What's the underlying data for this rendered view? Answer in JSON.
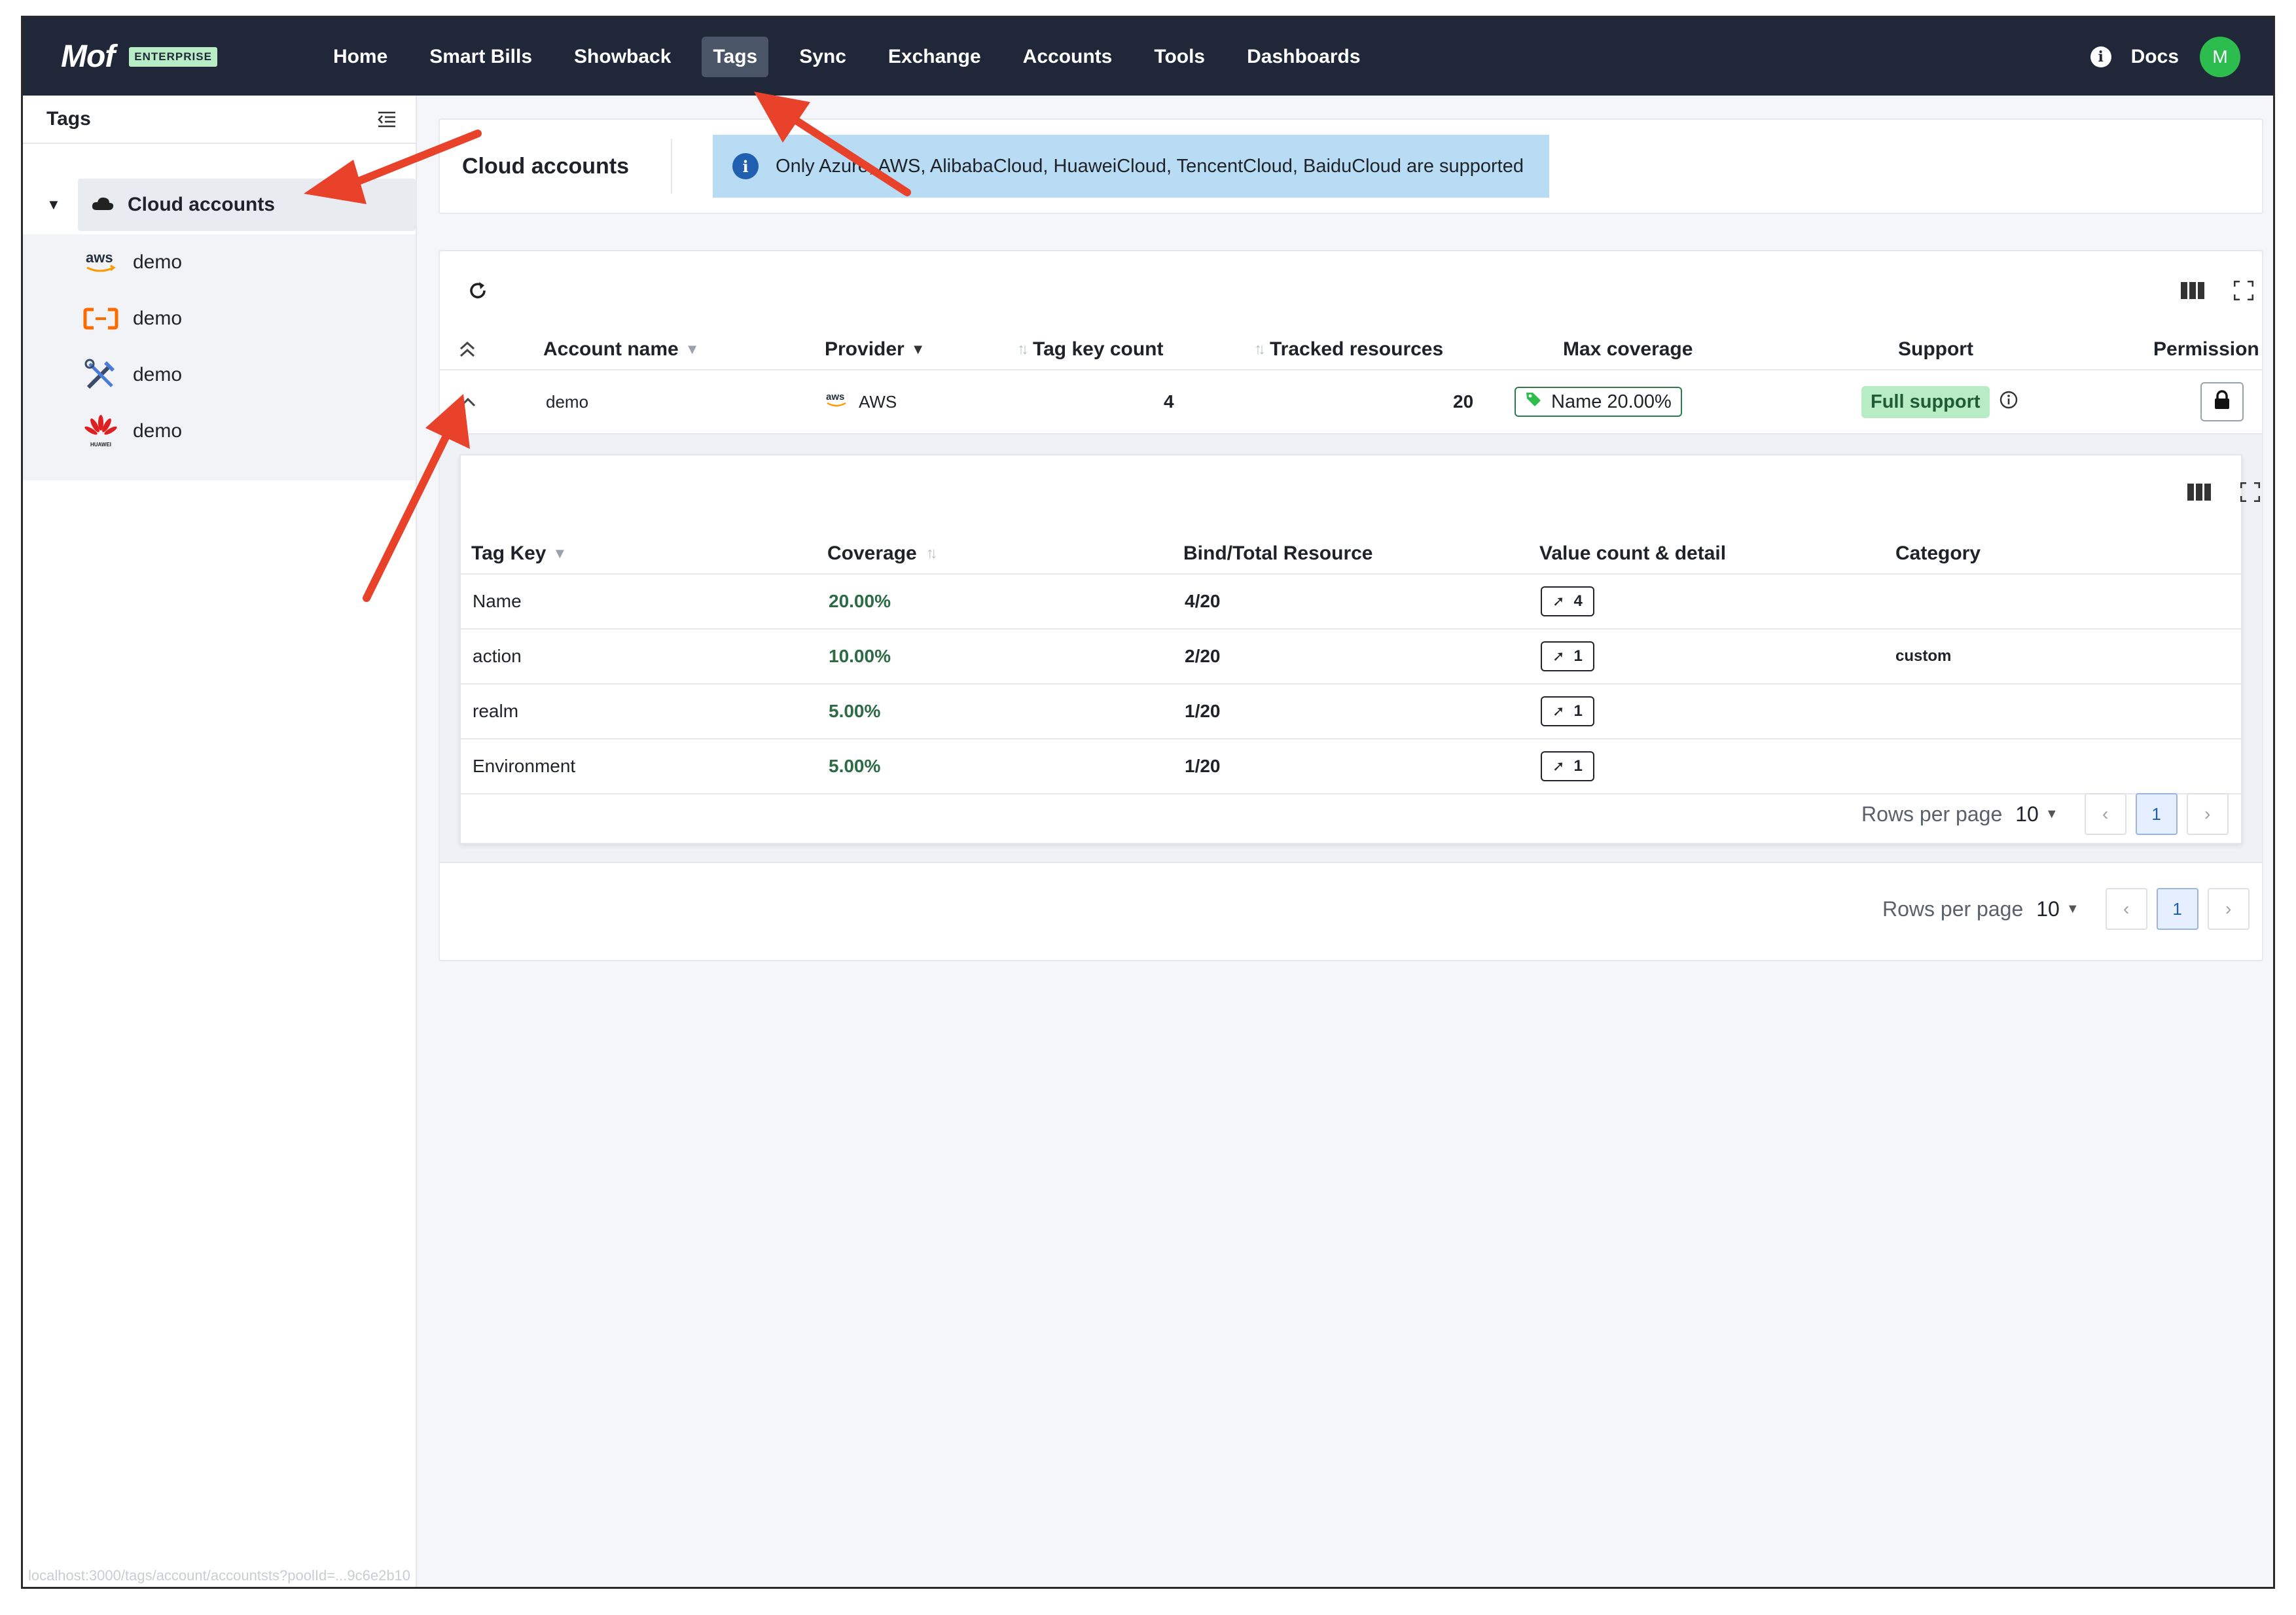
{
  "brand": {
    "logo": "Mof",
    "badge": "ENTERPRISE"
  },
  "nav": {
    "items": [
      {
        "label": "Home",
        "active": false
      },
      {
        "label": "Smart Bills",
        "active": false
      },
      {
        "label": "Showback",
        "active": false
      },
      {
        "label": "Tags",
        "active": true
      },
      {
        "label": "Sync",
        "active": false
      },
      {
        "label": "Exchange",
        "active": false
      },
      {
        "label": "Accounts",
        "active": false
      },
      {
        "label": "Tools",
        "active": false
      },
      {
        "label": "Dashboards",
        "active": false
      }
    ],
    "docs": "Docs",
    "avatar_initial": "M",
    "info_icon": "info-icon"
  },
  "sidebar": {
    "title": "Tags",
    "root": {
      "label": "Cloud accounts",
      "icon": "cloud-icon",
      "expanded": true
    },
    "children": [
      {
        "label": "demo",
        "provider": "aws"
      },
      {
        "label": "demo",
        "provider": "alibabacloud"
      },
      {
        "label": "demo",
        "provider": "tools"
      },
      {
        "label": "demo",
        "provider": "huawei"
      }
    ],
    "status_url": "localhost:3000/tags/account/accountsts?poolId=...9c6e2b10"
  },
  "header": {
    "title": "Cloud accounts",
    "alert": "Only Azure, AWS, AlibabaCloud, HuaweiCloud, TencentCloud, BaiduCloud are supported"
  },
  "accounts_table": {
    "columns": {
      "account_name": "Account name",
      "provider": "Provider",
      "tag_key_count": "Tag key count",
      "tracked_resources": "Tracked resources",
      "max_coverage": "Max coverage",
      "support": "Support",
      "permission": "Permission"
    },
    "rows": [
      {
        "account_name": "demo",
        "provider": "AWS",
        "provider_logo": "aws",
        "tag_key_count": "4",
        "tracked_resources": "20",
        "max_coverage": "Name 20.00%",
        "support": "Full support"
      }
    ],
    "footer": {
      "rows_per_page_label": "Rows per page",
      "rows_per_page": "10",
      "page": "1"
    }
  },
  "tag_keys_table": {
    "columns": {
      "tag_key": "Tag Key",
      "coverage": "Coverage",
      "bind_total": "Bind/Total Resource",
      "value_count": "Value count & detail",
      "category": "Category"
    },
    "rows": [
      {
        "tag_key": "Name",
        "coverage": "20.00%",
        "bind_total": "4/20",
        "value_count": "4",
        "category": ""
      },
      {
        "tag_key": "action",
        "coverage": "10.00%",
        "bind_total": "2/20",
        "value_count": "1",
        "category": "custom"
      },
      {
        "tag_key": "realm",
        "coverage": "5.00%",
        "bind_total": "1/20",
        "value_count": "1",
        "category": ""
      },
      {
        "tag_key": "Environment",
        "coverage": "5.00%",
        "bind_total": "1/20",
        "value_count": "1",
        "category": ""
      }
    ],
    "footer": {
      "rows_per_page_label": "Rows per page",
      "rows_per_page": "10",
      "page": "1"
    }
  },
  "colors": {
    "nav_bg": "#1f2738",
    "accent_green": "#2dbd4e",
    "coverage_green": "#2d6b45",
    "alert_bg": "#b8dcf3",
    "annotation_arrow": "#e8422a"
  }
}
